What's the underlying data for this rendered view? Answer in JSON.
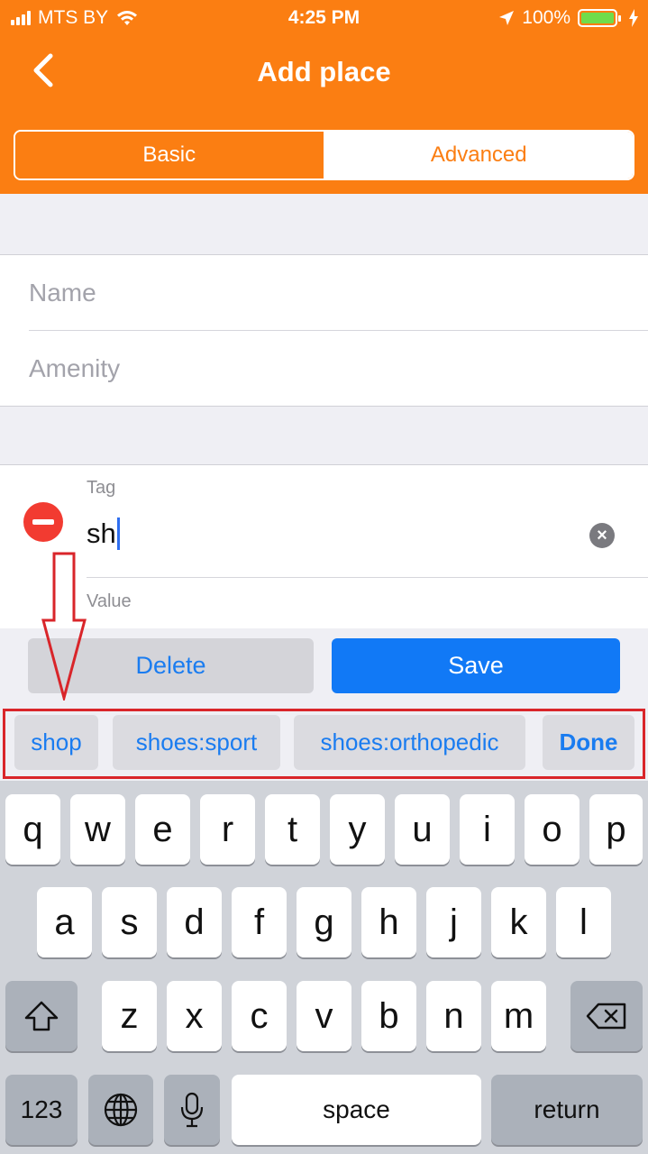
{
  "status_bar": {
    "carrier": "MTS BY",
    "time": "4:25 PM",
    "battery": "100%",
    "icons": [
      "signal-icon",
      "wifi-icon",
      "location-arrow-icon",
      "battery-icon",
      "charging-bolt-icon"
    ]
  },
  "nav": {
    "title": "Add place",
    "back_icon": "chevron-left-icon"
  },
  "segments": [
    {
      "label": "Basic",
      "selected": true
    },
    {
      "label": "Advanced",
      "selected": false
    }
  ],
  "form": {
    "name_placeholder": "Name",
    "amenity_placeholder": "Amenity"
  },
  "tag_editor": {
    "tag_label": "Tag",
    "tag_value": "sh",
    "value_label": "Value",
    "remove_icon": "minus-circle-icon",
    "clear_icon": "clear-x-icon"
  },
  "actions": {
    "delete_label": "Delete",
    "save_label": "Save"
  },
  "suggestions": {
    "items": [
      "shop",
      "shoes:sport",
      "shoes:orthopedic"
    ],
    "done_label": "Done"
  },
  "keyboard": {
    "row1": [
      "q",
      "w",
      "e",
      "r",
      "t",
      "y",
      "u",
      "i",
      "o",
      "p"
    ],
    "row2": [
      "a",
      "s",
      "d",
      "f",
      "g",
      "h",
      "j",
      "k",
      "l"
    ],
    "row3": [
      "z",
      "x",
      "c",
      "v",
      "b",
      "n",
      "m"
    ],
    "numbers_label": "123",
    "space_label": "space",
    "return_label": "return"
  },
  "colors": {
    "accent": "#fb7e12",
    "link_blue": "#1a7cf0",
    "save_blue": "#1179f6",
    "destructive_red": "#f23b31",
    "annotation_red": "#d9252a"
  }
}
